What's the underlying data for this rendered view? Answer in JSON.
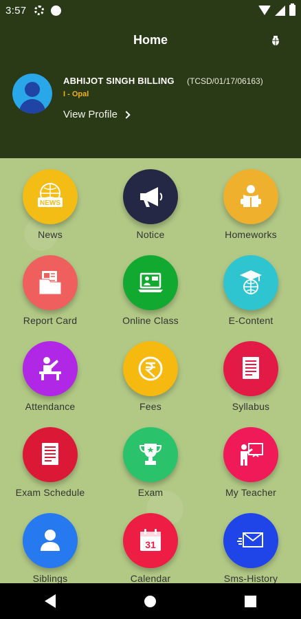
{
  "status": {
    "time": "3:57"
  },
  "header": {
    "title": "Home",
    "name": "ABHIJOT SINGH BILLING",
    "id": "(TCSD/01/17/06163)",
    "class": "I - Opal",
    "view_profile": "View Profile"
  },
  "menu": [
    {
      "label": "News",
      "icon": "newspaper-icon"
    },
    {
      "label": "Notice",
      "icon": "megaphone-icon"
    },
    {
      "label": "Homeworks",
      "icon": "reading-person-icon"
    },
    {
      "label": "Report Card",
      "icon": "report-card-icon"
    },
    {
      "label": "Online Class",
      "icon": "laptop-icon"
    },
    {
      "label": "E-Content",
      "icon": "globe-graduation-icon"
    },
    {
      "label": "Attendance",
      "icon": "desk-person-icon"
    },
    {
      "label": "Fees",
      "icon": "rupee-icon"
    },
    {
      "label": "Syllabus",
      "icon": "document-icon"
    },
    {
      "label": "Exam Schedule",
      "icon": "document-icon"
    },
    {
      "label": "Exam",
      "icon": "trophy-icon"
    },
    {
      "label": "My Teacher",
      "icon": "teacher-board-icon"
    },
    {
      "label": "Siblings",
      "icon": "person-icon"
    },
    {
      "label": "Calendar",
      "icon": "calendar-icon"
    },
    {
      "label": "Sms-History",
      "icon": "envelope-icon"
    }
  ],
  "calendar_day": "31",
  "colors": {
    "header": "#2b3a16",
    "grid_background": "#b2c986",
    "news": "#f4bd16",
    "notice": "#252844",
    "homeworks": "#efb02d",
    "report_card": "#ee5f5d",
    "online_class": "#11a930",
    "econtent": "#2ec4d0",
    "attendance": "#b127e6",
    "fees": "#f5b90f",
    "syllabus": "#e21a45",
    "exam_schedule": "#db1836",
    "exam": "#2ac36b",
    "teacher": "#f01a58",
    "siblings": "#2779f0",
    "calendar": "#ee1d43",
    "sms_history": "#1f44e8"
  }
}
